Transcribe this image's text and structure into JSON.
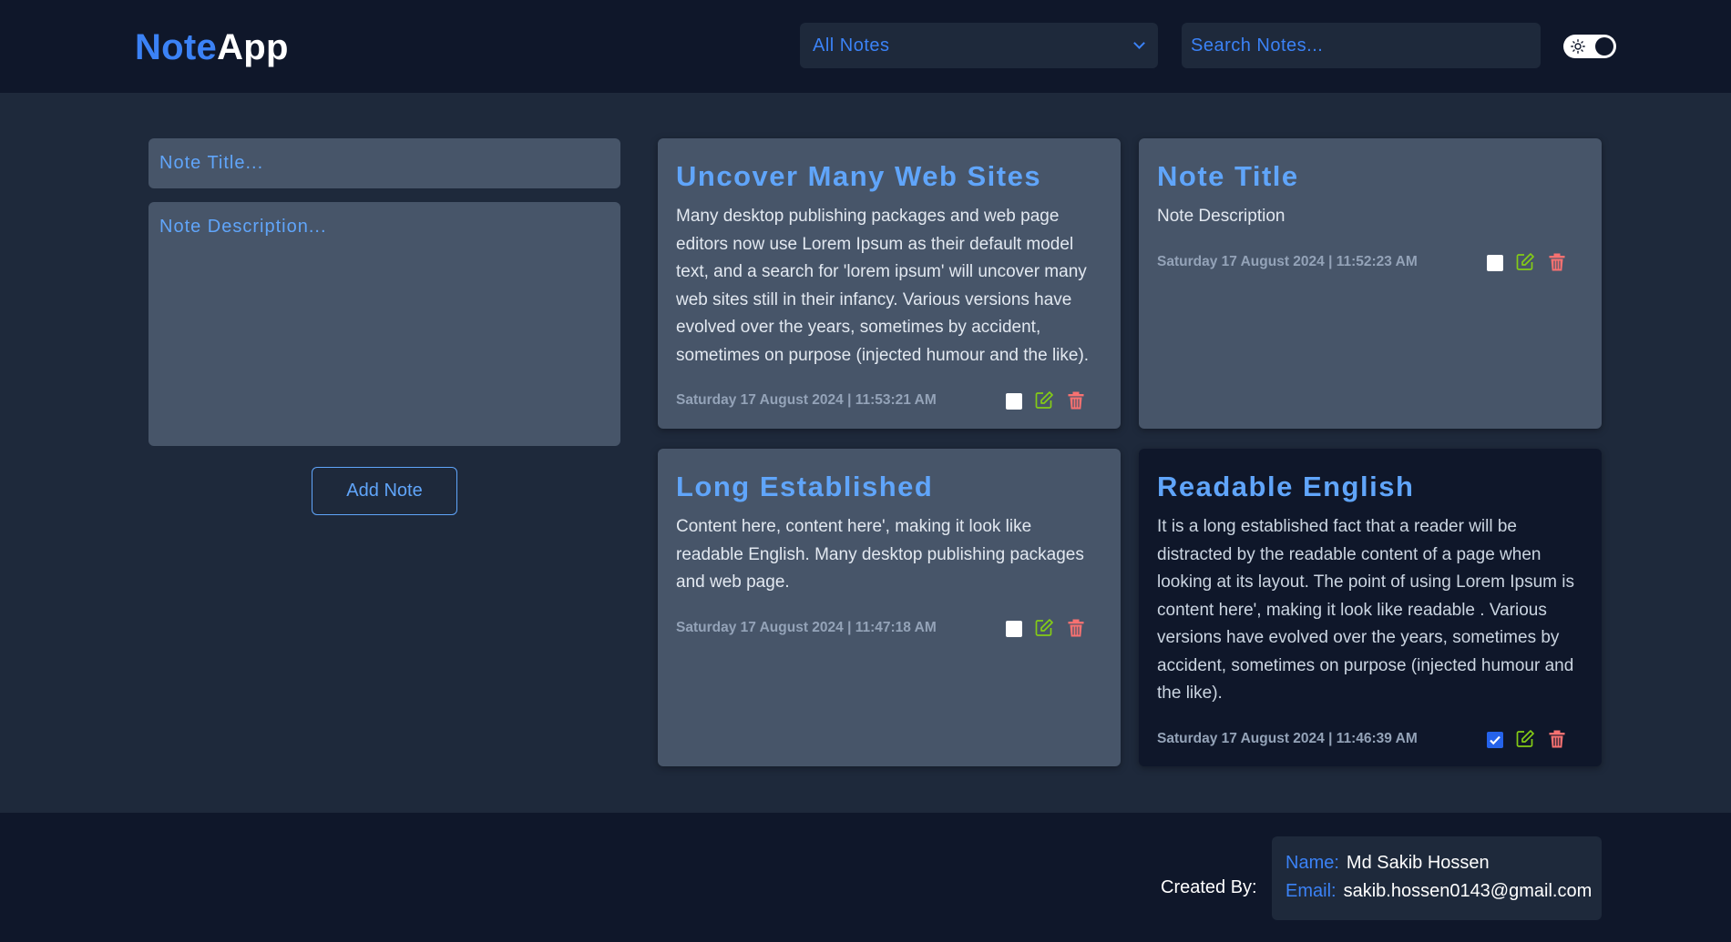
{
  "app": {
    "logo_part1": "Note",
    "logo_part2": "App"
  },
  "header": {
    "filter_selected": "All Notes",
    "search_placeholder": "Search Notes..."
  },
  "form": {
    "title_placeholder": "Note Title...",
    "description_placeholder": "Note Description...",
    "add_button_label": "Add Note"
  },
  "notes": [
    {
      "title": "Uncover Many Web Sites",
      "description": "Many desktop publishing packages and web page editors now use Lorem Ipsum as their default model text, and a search for 'lorem ipsum' will uncover many web sites still in their infancy. Various versions have evolved over the years, sometimes by accident, sometimes on purpose (injected humour and the like).",
      "date": "Saturday 17 August 2024 | 11:53:21 AM",
      "completed": false
    },
    {
      "title": "Note Title",
      "description": "Note Description",
      "date": "Saturday 17 August 2024 | 11:52:23 AM",
      "completed": false
    },
    {
      "title": "Long Established",
      "description": "Content here, content here', making it look like readable English. Many desktop publishing packages and web page.",
      "date": "Saturday 17 August 2024 | 11:47:18 AM",
      "completed": false
    },
    {
      "title": "Readable English",
      "description": "It is a long established fact that a reader will be distracted by the readable content of a page when looking at its layout. The point of using Lorem Ipsum is content here', making it look like readable . Various versions have evolved over the years, sometimes by accident, sometimes on purpose (injected humour and the like).",
      "date": "Saturday 17 August 2024 | 11:46:39 AM",
      "completed": true
    }
  ],
  "footer": {
    "created_by_label": "Created By:",
    "name_label": "Name:",
    "name_value": "Md Sakib Hossen",
    "email_label": "Email:",
    "email_value": "sakib.hossen0143@gmail.com"
  },
  "colors": {
    "accent": "#3b82f6",
    "edit": "#84cc16",
    "delete": "#f87171",
    "background": "#1e293b",
    "header": "#0f172a"
  }
}
